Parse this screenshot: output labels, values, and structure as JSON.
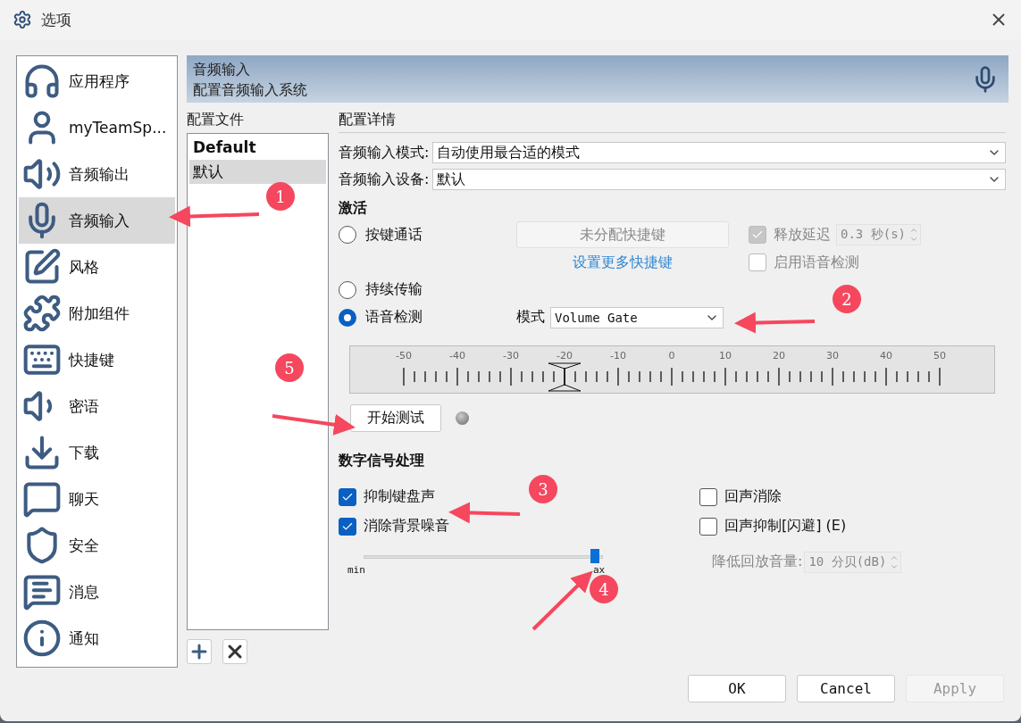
{
  "window": {
    "title": "选项"
  },
  "sidebar": {
    "items": [
      {
        "label": "应用程序",
        "kind": "app",
        "selected": false
      },
      {
        "label": "myTeamSp...",
        "kind": "user",
        "selected": false
      },
      {
        "label": "音频输出",
        "kind": "speaker",
        "selected": false
      },
      {
        "label": "音频输入",
        "kind": "mic",
        "selected": true
      },
      {
        "label": "风格",
        "kind": "pen",
        "selected": false
      },
      {
        "label": "附加组件",
        "kind": "puzzle",
        "selected": false
      },
      {
        "label": "快捷键",
        "kind": "key",
        "selected": false
      },
      {
        "label": "密语",
        "kind": "whisper",
        "selected": false
      },
      {
        "label": "下载",
        "kind": "download",
        "selected": false
      },
      {
        "label": "聊天",
        "kind": "chat",
        "selected": false
      },
      {
        "label": "安全",
        "kind": "shield",
        "selected": false
      },
      {
        "label": "消息",
        "kind": "message",
        "selected": false
      },
      {
        "label": "通知",
        "kind": "info",
        "selected": false
      }
    ]
  },
  "banner": {
    "title": "音频输入",
    "subtitle": "配置音频输入系统"
  },
  "profiles": {
    "heading": "配置文件",
    "items": [
      {
        "label": "Default",
        "bold": true,
        "selected": false
      },
      {
        "label": "默认",
        "bold": false,
        "selected": true
      }
    ]
  },
  "details": {
    "heading": "配置详情",
    "fields": [
      {
        "label": "音频输入模式:",
        "value": "自动使用最合适的模式"
      },
      {
        "label": "音频输入设备:",
        "value": "默认"
      }
    ]
  },
  "activation": {
    "heading": "激活",
    "modes": [
      {
        "label": "按键通话",
        "selected": false
      },
      {
        "label": "持续传输",
        "selected": false
      },
      {
        "label": "语音检测",
        "selected": true
      }
    ],
    "hotkey_button": {
      "label": "未分配快捷键",
      "disabled": true
    },
    "hotkey_link": "设置更多快捷键",
    "release_delay": {
      "label": "释放延迟",
      "checked": true,
      "disabled": true,
      "value": "0.3 秒(s)"
    },
    "voice_detect": {
      "label": "启用语音检测",
      "checked": false,
      "disabled": true
    },
    "mode_label": "模式",
    "mode_value": "Volume Gate",
    "meter": {
      "ticks": [
        "-50",
        "-40",
        "-30",
        "-20",
        "-10",
        "0",
        "10",
        "20",
        "30",
        "40",
        "50"
      ],
      "level": 0.3
    },
    "test_button": "开始测试"
  },
  "dsp": {
    "heading": "数字信号处理",
    "options": [
      {
        "label": "抑制键盘声",
        "checked": true
      },
      {
        "label": "回声消除",
        "checked": false
      },
      {
        "label": "消除背景噪音",
        "checked": true
      },
      {
        "label": "回声抑制[闪避] (E)",
        "checked": false
      }
    ],
    "noise_slider": {
      "level": 0.97,
      "min_label": "min",
      "max_label": "ax"
    },
    "ducking": {
      "label": "降低回放音量:",
      "value": "10 分贝(dB)",
      "disabled": true
    }
  },
  "buttons": [
    {
      "label": "OK",
      "disabled": false
    },
    {
      "label": "Cancel",
      "disabled": false
    },
    {
      "label": "Apply",
      "disabled": true
    }
  ],
  "annotations": [
    {
      "label": "1"
    },
    {
      "label": "2"
    },
    {
      "label": "3"
    },
    {
      "label": "4"
    },
    {
      "label": "5"
    }
  ]
}
